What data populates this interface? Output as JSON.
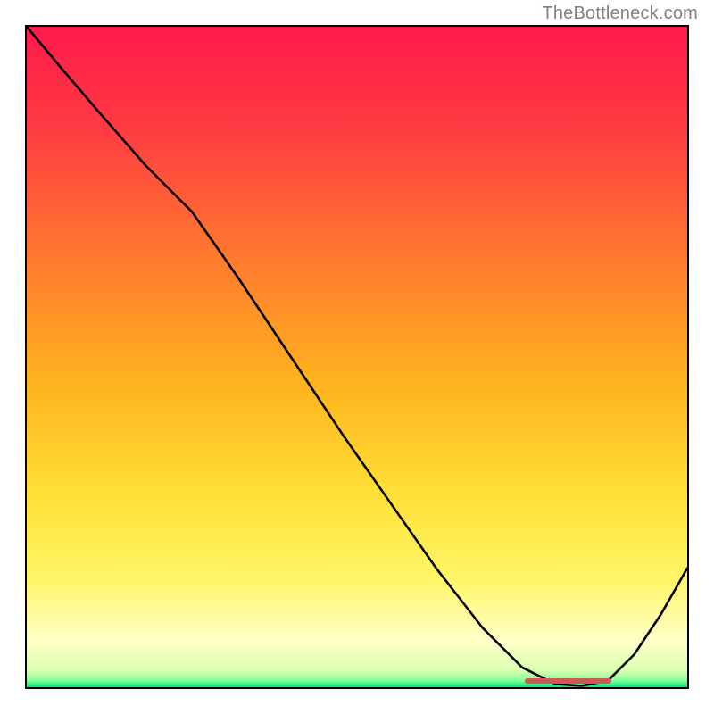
{
  "watermark": "TheBottleneck.com",
  "chart_data": {
    "type": "line",
    "title": "",
    "xlabel": "",
    "ylabel": "",
    "xlim": [
      0,
      100
    ],
    "ylim": [
      0,
      100
    ],
    "x": [
      0,
      5,
      11,
      18,
      25,
      32,
      40,
      48,
      55,
      62,
      69,
      75,
      80,
      84,
      88,
      92,
      96,
      100
    ],
    "values": [
      100,
      94,
      87,
      79,
      72,
      62,
      50,
      38,
      28,
      18,
      9,
      3,
      0.5,
      0.2,
      1,
      5,
      11,
      18
    ],
    "optimal_range_x": [
      75,
      88
    ],
    "gradient_stops": [
      {
        "pos": 0.0,
        "color": "#ff1a4a"
      },
      {
        "pos": 0.15,
        "color": "#ff3a42"
      },
      {
        "pos": 0.35,
        "color": "#ff7a2e"
      },
      {
        "pos": 0.55,
        "color": "#ffb61e"
      },
      {
        "pos": 0.72,
        "color": "#ffe23a"
      },
      {
        "pos": 0.84,
        "color": "#fff66a"
      },
      {
        "pos": 0.93,
        "color": "#ffffc8"
      },
      {
        "pos": 0.975,
        "color": "#d9ffb0"
      },
      {
        "pos": 0.99,
        "color": "#7fff9a"
      },
      {
        "pos": 1.0,
        "color": "#00e878"
      }
    ],
    "marker_color": "#cc5a52"
  }
}
